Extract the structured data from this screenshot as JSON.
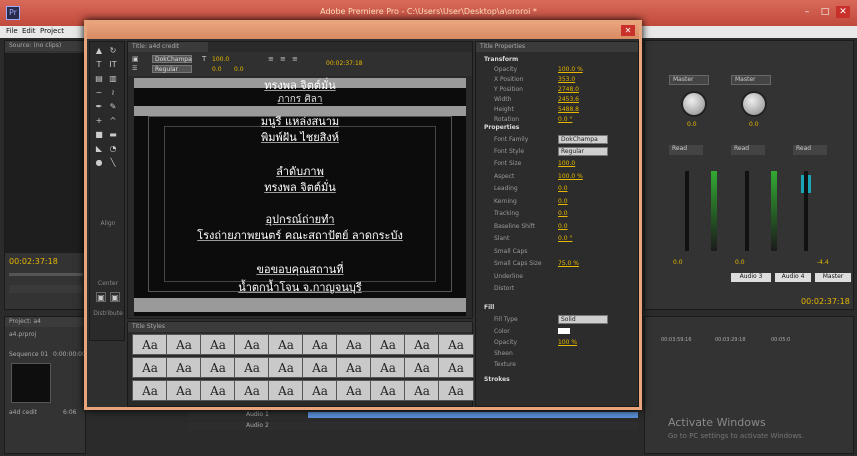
{
  "window": {
    "title": "Adobe Premiere Pro - C:\\Users\\User\\Desktop\\a\\ororoi *",
    "icon": "Pr",
    "minimize": "–",
    "maximize": "□",
    "close": "✕"
  },
  "menu": [
    "File",
    "Edit",
    "Project"
  ],
  "left": {
    "source_tab": "Source: (no clips)",
    "timecode": "00:02:37:18",
    "project_tab": "Project: a4",
    "project_file": "a4.prproj",
    "sequence": "Sequence 01",
    "seq_time": "0:00:00:00",
    "clip_name": "a4d cedit",
    "clip_duration": "6:06"
  },
  "mixer": {
    "tracks": [
      "Audio 3",
      "Audio 4",
      "Master"
    ],
    "dropdown": "Master",
    "read": "Read",
    "knob_vals": [
      "0.0",
      "0.0"
    ],
    "fader_vals": [
      "0.0",
      "0.0",
      "-4.4"
    ],
    "timecode": "00:02:37:18",
    "tl_times": [
      "00:03:59:16",
      "00:03:29:18",
      "00:05:0"
    ]
  },
  "timeline": {
    "audio1": "Audio 1",
    "audio2": "Audio 2"
  },
  "dialog": {
    "title_tab": "Title: a4d credit",
    "font": "DokChampa",
    "style": "Regular",
    "size": "100.0",
    "kerning": "0.0",
    "leading": "0.0",
    "timecode": "00:02:37:18",
    "credits": [
      "ทรงพล  จิตต์มั่น",
      "ภากร  ศิลา",
      "มนูรี  แหล่งสนาม",
      "พิมพ์ฝัน  ไชยสิงห์",
      "ลำดับภาพ",
      "ทรงพล  จิตต์มั่น",
      "อุปกรณ์ถ่ายทำ",
      "โรงถ่ายภาพยนตร์  คณะสถาปัตย์  ลาดกระบัง",
      "ขอขอบคุณสถานที่",
      "น้ำตกน้ำโจน  จ.กาญจนบุรี"
    ],
    "tools_align": "Align",
    "tools_center": "Center",
    "tools_distribute": "Distribute",
    "styles_tab": "Title Styles",
    "swatches": [
      "Aa",
      "Aa",
      "Aa",
      "Aa",
      "Aa",
      "Aa",
      "Aa",
      "Aa",
      "Aa",
      "Aa",
      "Aa",
      "Aa",
      "Aa",
      "Aa",
      "Aa",
      "Aa",
      "Aa",
      "Aa",
      "Aa",
      "Aa",
      "Aa",
      "Aa",
      "Aa",
      "Aa",
      "Aa",
      "Aa",
      "Aa",
      "Aa",
      "Aa",
      "Aa"
    ],
    "props_tab": "Title Properties",
    "transform_head": "Transform",
    "transform": [
      {
        "l": "Opacity",
        "v": "100.0 %"
      },
      {
        "l": "X Position",
        "v": "353.0"
      },
      {
        "l": "Y Position",
        "v": "2748.0"
      },
      {
        "l": "Width",
        "v": "2453.6"
      },
      {
        "l": "Height",
        "v": "5488.8"
      },
      {
        "l": "Rotation",
        "v": "0.0 °"
      }
    ],
    "properties_head": "Properties",
    "font_family_label": "Font Family",
    "font_family": "DokChampa",
    "font_style_label": "Font Style",
    "font_style": "Regular",
    "props": [
      {
        "l": "Font Size",
        "v": "100.0"
      },
      {
        "l": "Aspect",
        "v": "100.0 %"
      },
      {
        "l": "Leading",
        "v": "0.0"
      },
      {
        "l": "Kerning",
        "v": "0.0"
      },
      {
        "l": "Tracking",
        "v": "0.0"
      },
      {
        "l": "Baseline Shift",
        "v": "0.0"
      },
      {
        "l": "Slant",
        "v": "0.0 °"
      },
      {
        "l": "Small Caps",
        "v": ""
      },
      {
        "l": "Small Caps Size",
        "v": "75.0 %"
      },
      {
        "l": "Underline",
        "v": ""
      },
      {
        "l": "Distort",
        "v": ""
      }
    ],
    "fill_head": "Fill",
    "fill_type_label": "Fill Type",
    "fill_type": "Solid",
    "fill": [
      {
        "l": "Color",
        "v": ""
      },
      {
        "l": "Opacity",
        "v": "100 %"
      },
      {
        "l": "Sheen",
        "v": ""
      },
      {
        "l": "Texture",
        "v": ""
      }
    ],
    "strokes_head": "Strokes"
  },
  "watermark": {
    "line1": "Activate Windows",
    "line2": "Go to PC settings to activate Windows."
  },
  "colors": {
    "titlebar": "#c9513f",
    "dialog_border": "#e8a47a",
    "accent": "#e6b800"
  }
}
